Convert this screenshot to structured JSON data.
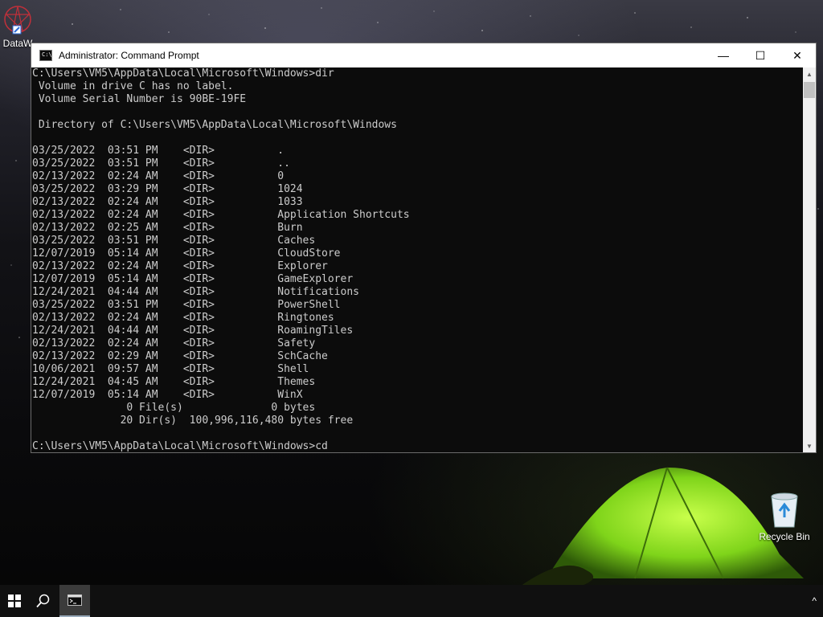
{
  "desktop": {
    "icons": [
      {
        "label": "DataW",
        "icon": "dataw-shortcut-icon"
      },
      {
        "label": "Recycle Bin",
        "icon": "recycle-bin-icon"
      }
    ]
  },
  "window": {
    "title": "Administrator: Command Prompt",
    "app_icon_text": "C:\\_",
    "controls": {
      "minimize": "—",
      "maximize": "☐",
      "close": "✕"
    }
  },
  "console": {
    "lines": [
      "C:\\Users\\VM5\\AppData\\Local\\Microsoft\\Windows>dir",
      " Volume in drive C has no label.",
      " Volume Serial Number is 90BE-19FE",
      "",
      " Directory of C:\\Users\\VM5\\AppData\\Local\\Microsoft\\Windows",
      "",
      "03/25/2022  03:51 PM    <DIR>          .",
      "03/25/2022  03:51 PM    <DIR>          ..",
      "02/13/2022  02:24 AM    <DIR>          0",
      "03/25/2022  03:29 PM    <DIR>          1024",
      "02/13/2022  02:24 AM    <DIR>          1033",
      "02/13/2022  02:24 AM    <DIR>          Application Shortcuts",
      "02/13/2022  02:25 AM    <DIR>          Burn",
      "03/25/2022  03:51 PM    <DIR>          Caches",
      "12/07/2019  05:14 AM    <DIR>          CloudStore",
      "02/13/2022  02:24 AM    <DIR>          Explorer",
      "12/07/2019  05:14 AM    <DIR>          GameExplorer",
      "12/24/2021  04:44 AM    <DIR>          Notifications",
      "03/25/2022  03:51 PM    <DIR>          PowerShell",
      "02/13/2022  02:24 AM    <DIR>          Ringtones",
      "12/24/2021  04:44 AM    <DIR>          RoamingTiles",
      "02/13/2022  02:24 AM    <DIR>          Safety",
      "02/13/2022  02:29 AM    <DIR>          SchCache",
      "10/06/2021  09:57 AM    <DIR>          Shell",
      "12/24/2021  04:45 AM    <DIR>          Themes",
      "12/07/2019  05:14 AM    <DIR>          WinX",
      "               0 File(s)              0 bytes",
      "              20 Dir(s)  100,996,116,480 bytes free",
      "",
      "C:\\Users\\VM5\\AppData\\Local\\Microsoft\\Windows>cd"
    ]
  },
  "taskbar": {
    "start_icon": "windows-logo-icon",
    "search_icon": "search-icon",
    "pinned": [
      {
        "name": "Command Prompt",
        "icon": "cmd-icon",
        "active": true
      }
    ],
    "tray_chevron": "^"
  },
  "colors": {
    "console_bg": "#0c0c0c",
    "console_fg": "#cccccc",
    "titlebar_bg": "#ffffff",
    "taskbar_bg": "#101010",
    "tent_green": "#9cff1e"
  }
}
